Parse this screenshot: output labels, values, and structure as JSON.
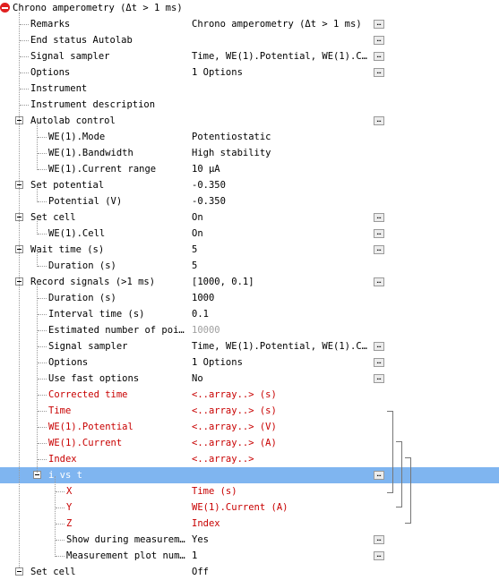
{
  "title": "Chrono amperometry (Δt > 1 ms)",
  "rows": [
    {
      "label": "Remarks",
      "value": "Chrono amperometry (Δt > 1 ms)"
    },
    {
      "label": "End status Autolab",
      "value": ""
    },
    {
      "label": "Signal sampler",
      "value": "Time, WE(1).Potential, WE(1).C…"
    },
    {
      "label": "Options",
      "value": "1 Options"
    },
    {
      "label": "Instrument",
      "value": ""
    },
    {
      "label": "Instrument description",
      "value": ""
    },
    {
      "label": "Autolab control",
      "value": ""
    },
    {
      "label": "WE(1).Mode",
      "value": "Potentiostatic"
    },
    {
      "label": "WE(1).Bandwidth",
      "value": "High stability"
    },
    {
      "label": "WE(1).Current range",
      "value": "10 μA"
    },
    {
      "label": "Set potential",
      "value": "-0.350"
    },
    {
      "label": "Potential (V)",
      "value": "-0.350"
    },
    {
      "label": "Set cell",
      "value": "On"
    },
    {
      "label": "WE(1).Cell",
      "value": "On"
    },
    {
      "label": "Wait time (s)",
      "value": "5"
    },
    {
      "label": "Duration (s)",
      "value": "5"
    },
    {
      "label": "Record signals (>1 ms)",
      "value": "[1000, 0.1]"
    },
    {
      "label": "Duration (s)",
      "value": "1000"
    },
    {
      "label": "Interval time (s)",
      "value": "0.1"
    },
    {
      "label": "Estimated number of poi…",
      "value": "10000"
    },
    {
      "label": "Signal sampler",
      "value": "Time, WE(1).Potential, WE(1).C…"
    },
    {
      "label": "Options",
      "value": "1 Options"
    },
    {
      "label": "Use fast options",
      "value": "No"
    },
    {
      "label": "Corrected time",
      "value": "<..array..> (s)"
    },
    {
      "label": "Time",
      "value": "<..array..> (s)"
    },
    {
      "label": "WE(1).Potential",
      "value": "<..array..> (V)"
    },
    {
      "label": "WE(1).Current",
      "value": "<..array..> (A)"
    },
    {
      "label": "Index",
      "value": "<..array..>"
    },
    {
      "label": "i vs t",
      "value": ""
    },
    {
      "label": "X",
      "value": "Time (s)"
    },
    {
      "label": "Y",
      "value": "WE(1).Current (A)"
    },
    {
      "label": "Z",
      "value": "Index"
    },
    {
      "label": "Show during measurem…",
      "value": "Yes"
    },
    {
      "label": "Measurement plot num…",
      "value": "1"
    },
    {
      "label": "Set cell",
      "value": "Off"
    }
  ],
  "colors": {
    "selected": "#7fb5f0",
    "output": "#c80000",
    "icon": "#e02020"
  },
  "icons": {
    "root": "stop-icon",
    "button": "ellipsis-icon",
    "toggle": "collapse-icon"
  }
}
